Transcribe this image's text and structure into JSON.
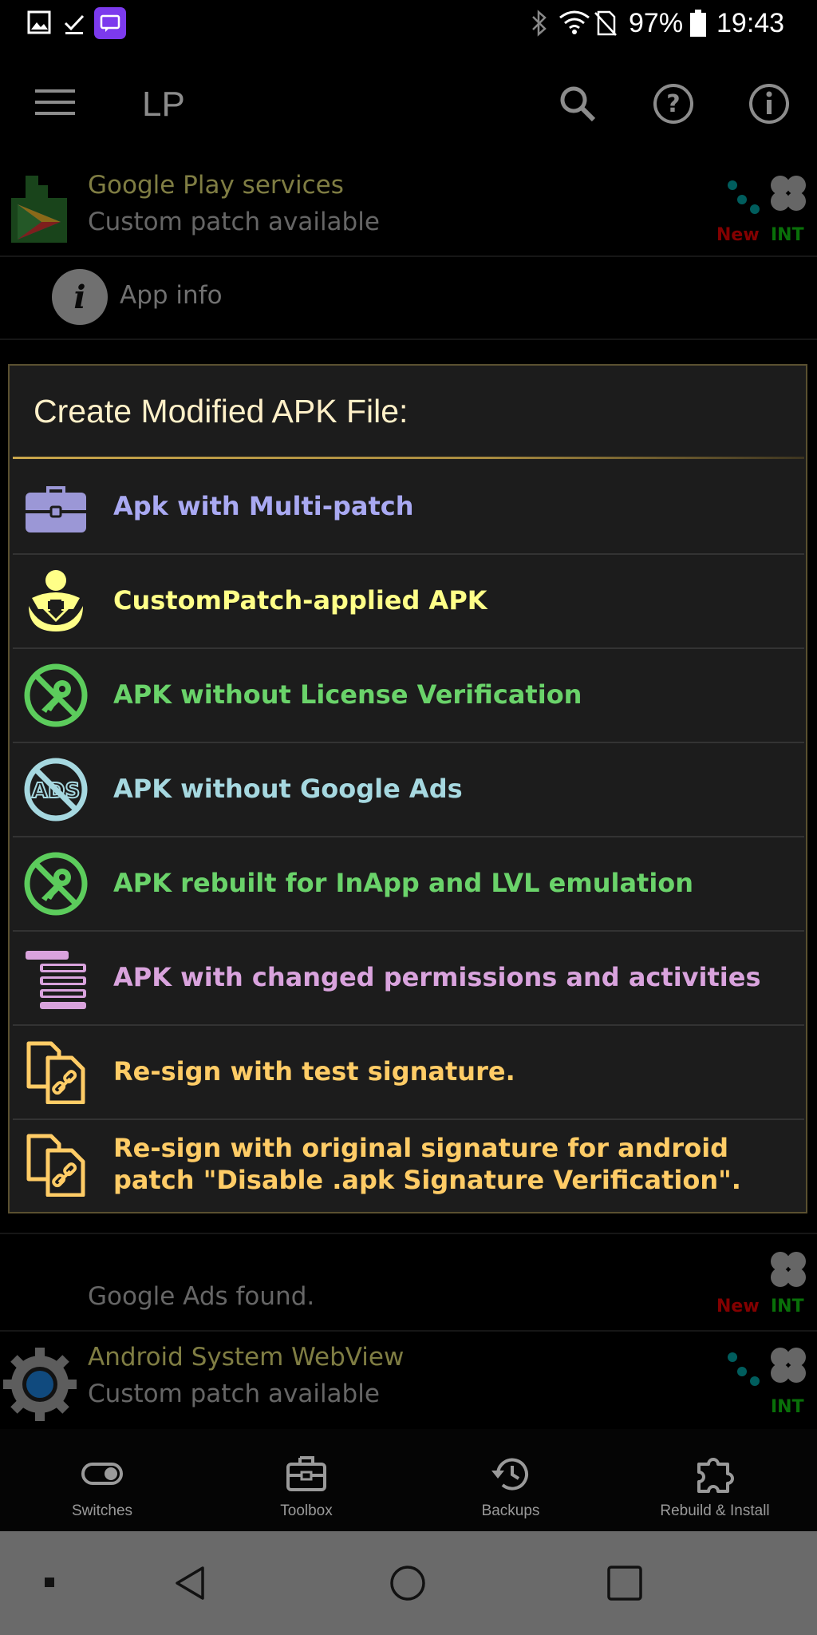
{
  "status_bar": {
    "battery": "97%",
    "time": "19:43"
  },
  "toolbar": {
    "title": "LP"
  },
  "apps": [
    {
      "name": "Google Play services",
      "status": "Custom patch available",
      "badge_new": "New",
      "badge_int": "INT"
    },
    {
      "name": "Android System WebView",
      "status": "Custom patch available",
      "badge_int": "INT"
    }
  ],
  "app_info": "App info",
  "ads_row": {
    "status": "Google Ads found.",
    "badge_new": "New",
    "badge_int": "INT"
  },
  "dialog": {
    "title": "Create Modified APK File:",
    "options": [
      {
        "label": "Apk with Multi-patch",
        "icon": "briefcase-icon",
        "color": "#a9a9f2"
      },
      {
        "label": "CustomPatch-applied APK",
        "icon": "person-download-icon",
        "color": "#ffff88"
      },
      {
        "label": "APK without License Verification",
        "icon": "no-key-icon",
        "color": "#6ad36a"
      },
      {
        "label": "APK without Google Ads",
        "icon": "no-ads-icon",
        "color": "#a6d8e0"
      },
      {
        "label": "APK rebuilt for InApp and LVL emulation",
        "icon": "no-key-icon",
        "color": "#6ad36a"
      },
      {
        "label": "APK with changed permissions and activities",
        "icon": "list-icon",
        "color": "#d9a3dd"
      },
      {
        "label": "Re-sign with test signature.",
        "icon": "copy-link-icon",
        "color": "#ffcc66"
      },
      {
        "label": "Re-sign with original signature for android patch \"Disable .apk Signature Verification\".",
        "icon": "copy-link-icon",
        "color": "#ffcc66"
      }
    ]
  },
  "bottom_nav": [
    {
      "label": "Switches",
      "icon": "toggle-icon"
    },
    {
      "label": "Toolbox",
      "icon": "toolbox-icon"
    },
    {
      "label": "Backups",
      "icon": "restore-icon"
    },
    {
      "label": "Rebuild & Install",
      "icon": "puzzle-icon"
    }
  ]
}
